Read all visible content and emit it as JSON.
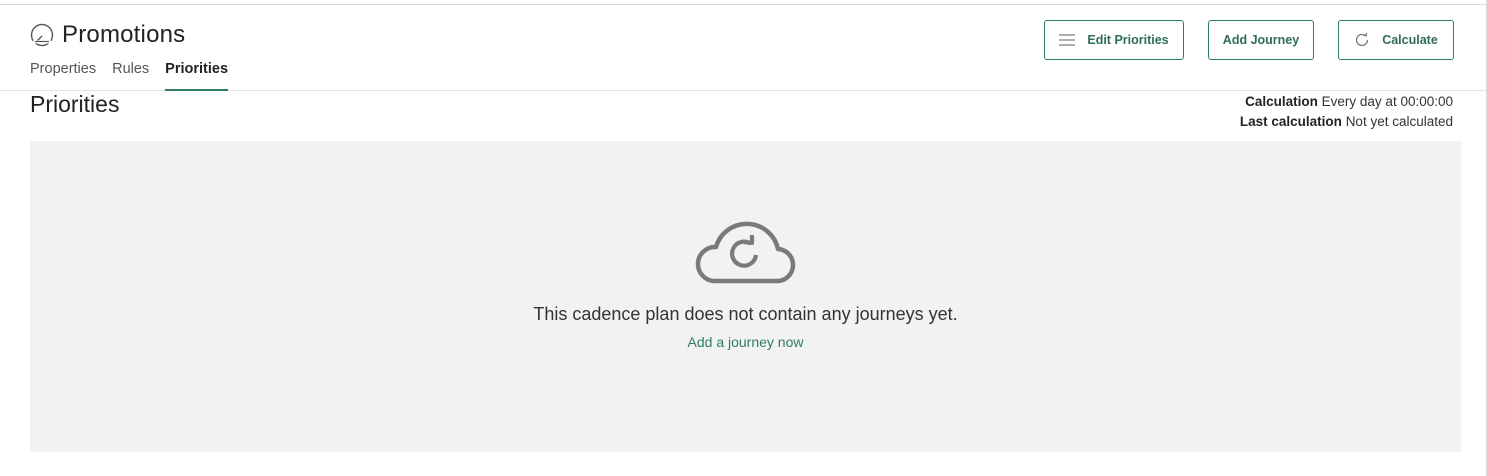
{
  "header": {
    "title": "Promotions",
    "title_icon": "speedometer-icon",
    "tabs": [
      {
        "label": "Properties",
        "active": false
      },
      {
        "label": "Rules",
        "active": false
      },
      {
        "label": "Priorities",
        "active": true
      }
    ],
    "buttons": {
      "edit_priorities": "Edit Priorities",
      "add_journey": "Add Journey",
      "calculate": "Calculate"
    }
  },
  "main": {
    "section_title": "Priorities",
    "calculation_label": "Calculation",
    "calculation_value": "Every day at 00:00:00",
    "last_calculation_label": "Last calculation",
    "last_calculation_value": "Not yet calculated",
    "empty_state": {
      "icon": "cloud-refresh-icon",
      "message": "This cadence plan does not contain any journeys yet.",
      "link": "Add a journey now"
    }
  },
  "colors": {
    "accent": "#2e7d67",
    "panel_bg": "#f2f2f2"
  }
}
